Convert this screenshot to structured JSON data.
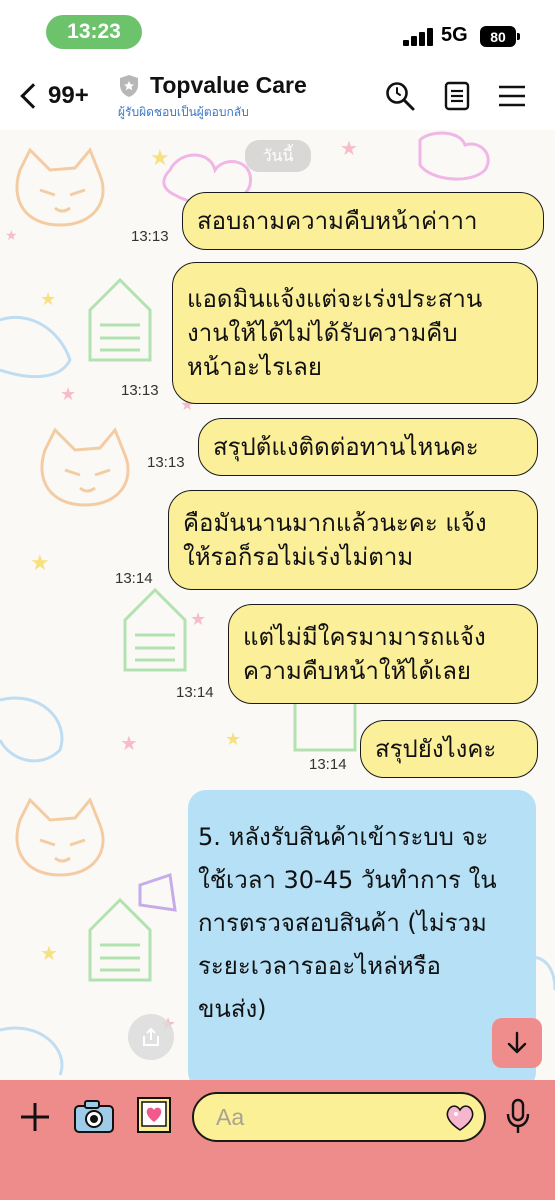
{
  "status_bar": {
    "time": "13:23",
    "network": "5G",
    "battery": "80"
  },
  "header": {
    "back_count": "99+",
    "title": "Topvalue Care",
    "subtitle": "ผู้รับผิดชอบเป็นผู้ตอบกลับ",
    "icons": [
      "back-chevron-icon",
      "shield-icon",
      "search-icon",
      "notes-icon",
      "menu-icon"
    ]
  },
  "chat": {
    "date_label": "วันนี้",
    "messages": [
      {
        "time": "13:13",
        "lines": [
          "สอบถามความคืบหน้าค่าาา"
        ]
      },
      {
        "time": "13:13",
        "lines": [
          "แอดมินแจ้งแต่จะเร่งประสาน",
          "งานให้ได้ไม่ได้รับความคืบ",
          "หน้าอะไรเลย"
        ]
      },
      {
        "time": "13:13",
        "lines": [
          "สรุปต้แงติดต่อทานไหนคะ"
        ]
      },
      {
        "time": "13:14",
        "lines": [
          "คือมันนานมากแล้วนะคะ แจ้ง",
          "ให้รอก็รอไม่เร่งไม่ตาม"
        ]
      },
      {
        "time": "13:14",
        "lines": [
          "แต่ไม่มีใครมามารถแจ้ง",
          "ความคืบหน้าให้ได้เลย"
        ]
      },
      {
        "time": "13:14",
        "lines": [
          "สรุปยังไงคะ"
        ]
      }
    ],
    "bot_message_lines": [
      "5. หลังรับสินค้าเข้าระบบ จะ",
      "ใช้เวลา 30-45 วันทำการ ใน",
      "การตรวจสอบสินค้า (ไม่รวม",
      "ระยะเวลารออะไหล่หรือ",
      "ขนส่ง)"
    ]
  },
  "input": {
    "placeholder": "Aa"
  },
  "colors": {
    "own_bubble": "#fbef9a",
    "bot_bubble": "#b5e0f6",
    "input_bar": "#ee8b8b",
    "time_pill": "#6cc36c",
    "subtitle": "#3a78c9"
  }
}
